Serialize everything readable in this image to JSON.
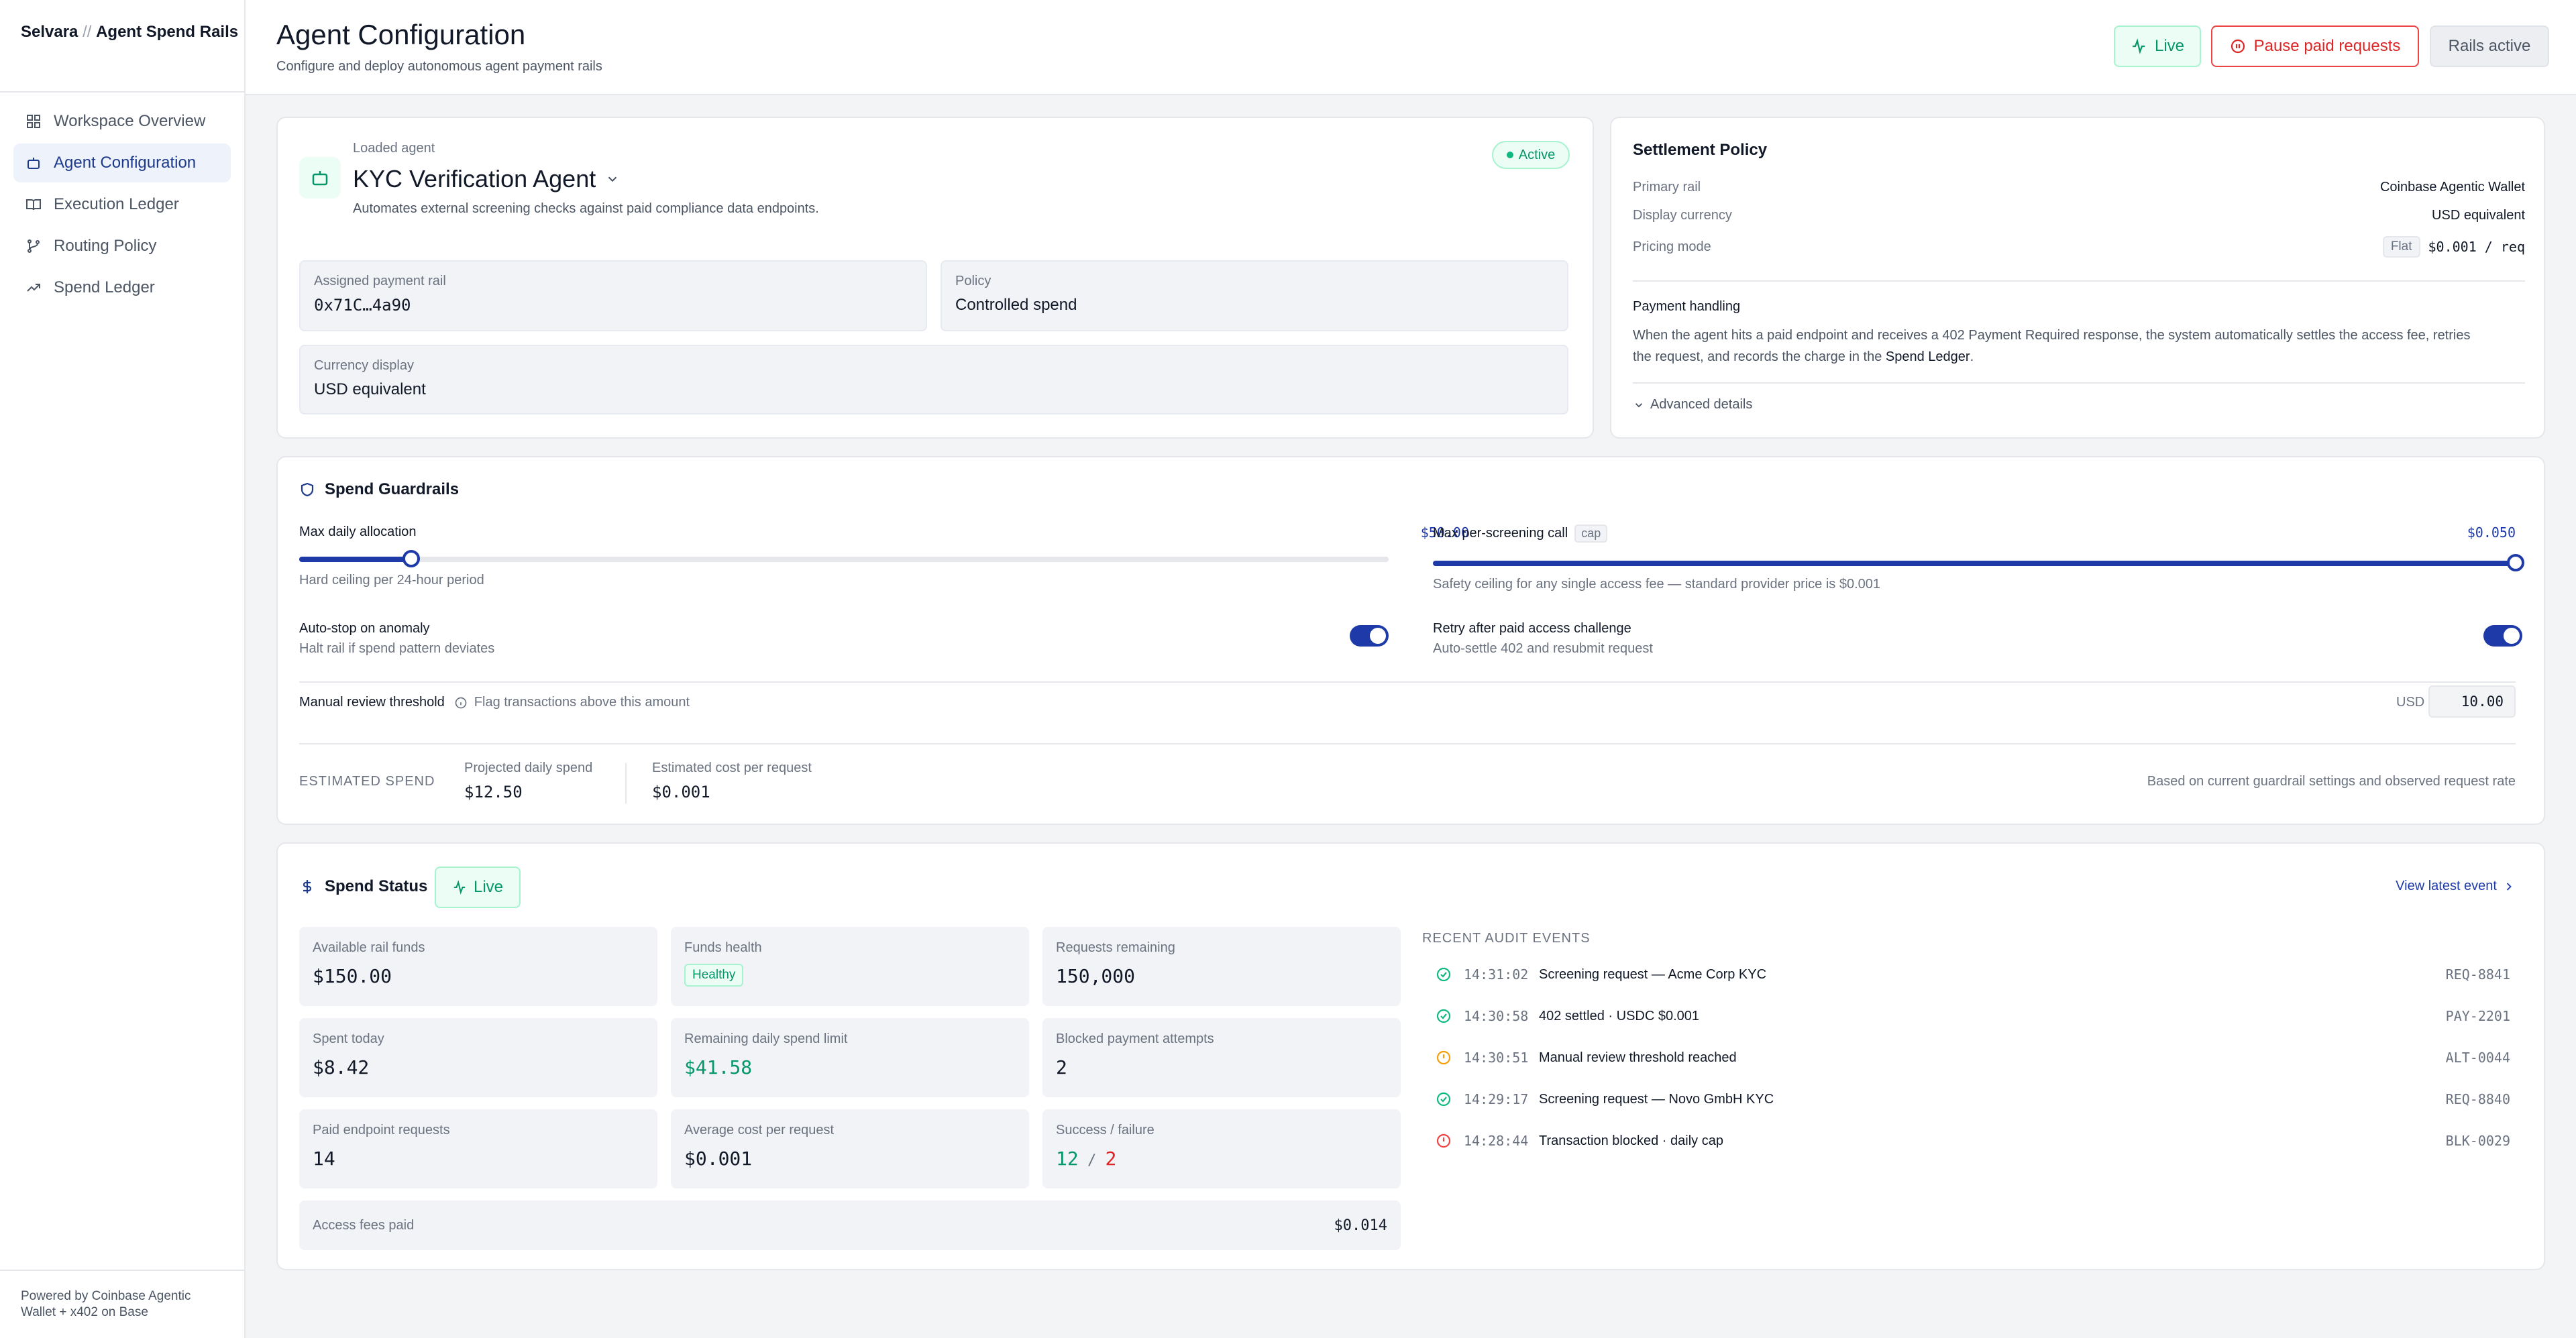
{
  "brand": {
    "name": "Selvara",
    "sep": " // ",
    "product": "Agent Spend Rails"
  },
  "sidebar": {
    "items": [
      {
        "label": "Workspace Overview",
        "icon": "grid-icon"
      },
      {
        "label": "Agent Configuration",
        "icon": "bot-icon",
        "active": true
      },
      {
        "label": "Execution Ledger",
        "icon": "book-icon"
      },
      {
        "label": "Routing Policy",
        "icon": "branch-icon"
      },
      {
        "label": "Spend Ledger",
        "icon": "trend-icon"
      }
    ],
    "footer": "Powered by Coinbase Agentic Wallet + x402 on Base"
  },
  "header": {
    "title": "Agent Configuration",
    "subtitle": "Configure and deploy autonomous agent payment rails",
    "live_label": "Live",
    "pause_label": "Pause paid requests",
    "rails_label": "Rails active"
  },
  "agent": {
    "loaded_label": "Loaded agent",
    "name": "KYC Verification Agent",
    "description": "Automates external screening checks against paid compliance data endpoints.",
    "status": "Active",
    "rail_label": "Assigned payment rail",
    "rail_value": "0x71C…4a90",
    "policy_label": "Policy",
    "policy_value": "Controlled spend",
    "currency_label": "Currency display",
    "currency_value": "USD equivalent"
  },
  "settlement": {
    "title": "Settlement Policy",
    "primary_rail_label": "Primary rail",
    "primary_rail_value": "Coinbase Agentic Wallet",
    "display_currency_label": "Display currency",
    "display_currency_value": "USD equivalent",
    "pricing_mode_label": "Pricing mode",
    "pricing_chip": "Flat",
    "pricing_value": "$0.001 / req",
    "handling_title": "Payment handling",
    "handling_text_1": "When the agent hits a paid endpoint and receives a 402 Payment Required response, the system automatically settles the access fee, retries",
    "handling_text_2": "the request, and records the charge in the ",
    "handling_link": "Spend Ledger",
    "handling_end": ".",
    "advanced_label": "Advanced details"
  },
  "guardrails": {
    "title": "Spend Guardrails",
    "daily_label": "Max daily allocation",
    "daily_value": "$50.00",
    "daily_fill": 0.103,
    "daily_sub": "Hard ceiling per 24-hour period",
    "per_call_label": "Max per-screening call",
    "per_call_chip": "cap",
    "per_call_value": "$0.050",
    "per_call_fill": 1.0,
    "per_call_sub": "Safety ceiling for any single access fee — standard provider price is $0.001",
    "autostop_label": "Auto-stop on anomaly",
    "autostop_sub": "Halt rail if spend pattern deviates",
    "autostop_on": true,
    "retry_label": "Retry after paid access challenge",
    "retry_sub": "Auto-settle 402 and resubmit request",
    "retry_on": true,
    "review_label": "Manual review threshold",
    "review_hint": "Flag transactions above this amount",
    "review_currency": "USD",
    "review_value": "10.00",
    "est_label": "ESTIMATED SPEND",
    "proj_label": "Projected daily spend",
    "proj_value": "$12.50",
    "cost_label": "Estimated cost per request",
    "cost_value": "$0.001",
    "est_note": "Based on current guardrail settings and observed request rate"
  },
  "status": {
    "title": "Spend Status",
    "live_label": "Live",
    "stats": [
      {
        "label": "Available rail funds",
        "value": "$150.00"
      },
      {
        "label": "Funds health",
        "value": "Healthy"
      },
      {
        "label": "Requests remaining",
        "value": "150,000"
      },
      {
        "label": "Spent today",
        "value": "$8.42"
      },
      {
        "label": "Remaining daily spend limit",
        "value": "$41.58"
      },
      {
        "label": "Blocked payment attempts",
        "value": "2"
      },
      {
        "label": "Paid endpoint requests",
        "value": "14"
      },
      {
        "label": "Average cost per request",
        "value": "$0.001"
      },
      {
        "label": "Success / failure",
        "success": "12",
        "slash": " / ",
        "failure": "2"
      }
    ],
    "fees_label": "Access fees paid",
    "fees_value": "$0.014",
    "events_title": "RECENT AUDIT EVENTS",
    "view_latest": "View latest event",
    "events": [
      {
        "time": "14:31:02",
        "text": "Screening request — Acme Corp KYC",
        "id": "REQ-8841",
        "kind": "success"
      },
      {
        "time": "14:30:58",
        "text": "402 settled · USDC $0.001",
        "id": "PAY-2201",
        "kind": "success"
      },
      {
        "time": "14:30:51",
        "text": "Manual review threshold reached",
        "id": "ALT-0044",
        "kind": "warning"
      },
      {
        "time": "14:29:17",
        "text": "Screening request — Novo GmbH KYC",
        "id": "REQ-8840",
        "kind": "success"
      },
      {
        "time": "14:28:44",
        "text": "Transaction blocked · daily cap",
        "id": "BLK-0029",
        "kind": "error"
      }
    ]
  },
  "colors": {
    "accent": "#1e3aa8",
    "success": "#059669",
    "warning": "#f59e0b",
    "danger": "#dc2626"
  }
}
